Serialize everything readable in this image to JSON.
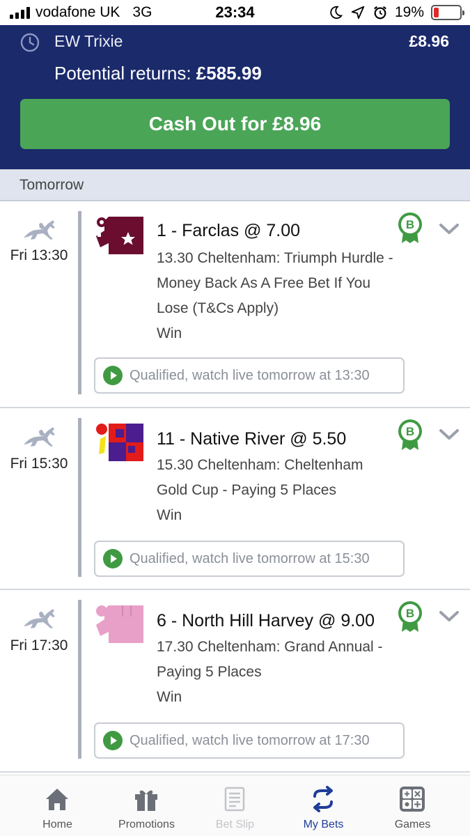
{
  "status_bar": {
    "carrier": "vodafone UK",
    "network": "3G",
    "time": "23:34",
    "battery_percent": "19%",
    "battery_level": 0.19,
    "battery_color": "#e02a2a"
  },
  "bet": {
    "type": "EW Trixie",
    "stake": "£8.96",
    "potential_label": "Potential returns:",
    "potential_value": "£585.99",
    "cashout_label": "Cash Out for £8.96",
    "header_color": "#1b2a6b",
    "cashout_color": "#4aa557"
  },
  "section": {
    "day_label": "Tomorrow"
  },
  "selections": [
    {
      "time": "Fri 13:30",
      "name": "1 - Farclas @ 7.00",
      "description": "13.30 Cheltenham: Triumph Hurdle - Money Back As A Free Bet If You Lose (T&Cs Apply)",
      "result": "Win",
      "badge": "B",
      "watch_label": "Qualified, watch live tomorrow at 13:30",
      "silks_icon": "maroon-silks-star-icon"
    },
    {
      "time": "Fri 15:30",
      "name": "11 - Native River @ 5.50",
      "description": "15.30 Cheltenham: Cheltenham Gold Cup - Paying 5 Places",
      "result": "Win",
      "badge": "B",
      "watch_label": "Qualified, watch live tomorrow at 15:30",
      "silks_icon": "red-purple-check-silks-icon"
    },
    {
      "time": "Fri 17:30",
      "name": "6 - North Hill Harvey @ 9.00",
      "description": "17.30 Cheltenham: Grand Annual - Paying 5 Places",
      "result": "Win",
      "badge": "B",
      "watch_label": "Qualified, watch live tomorrow at 17:30",
      "silks_icon": "pink-silks-icon"
    }
  ],
  "tabs": [
    {
      "label": "Home",
      "icon": "home-icon",
      "state": "normal"
    },
    {
      "label": "Promotions",
      "icon": "gift-icon",
      "state": "normal"
    },
    {
      "label": "Bet Slip",
      "icon": "betslip-icon",
      "state": "disabled"
    },
    {
      "label": "My Bets",
      "icon": "my-bets-icon",
      "state": "active"
    },
    {
      "label": "Games",
      "icon": "games-icon",
      "state": "normal"
    }
  ],
  "colors": {
    "accent_green": "#4aa557",
    "badge_green": "#3f9a42",
    "active_tab": "#1f3d99",
    "divider": "#a9afbc"
  }
}
